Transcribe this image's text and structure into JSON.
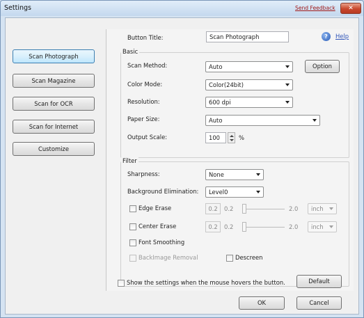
{
  "window": {
    "title": "Settings",
    "feedback_label": "Send Feedback",
    "close_glyph": "✕"
  },
  "sidebar": {
    "items": [
      {
        "label": "Scan Photograph",
        "active": true
      },
      {
        "label": "Scan Magazine"
      },
      {
        "label": "Scan for OCR"
      },
      {
        "label": "Scan for Internet"
      },
      {
        "label": "Customize"
      }
    ]
  },
  "header": {
    "button_title_label": "Button Title:",
    "button_title_value": "Scan Photograph",
    "help_glyph": "?",
    "help_label": "Help"
  },
  "basic": {
    "group_label": "Basic",
    "scan_method_label": "Scan Method:",
    "scan_method_value": "Auto",
    "option_button": "Option",
    "color_mode_label": "Color Mode:",
    "color_mode_value": "Color(24bit)",
    "resolution_label": "Resolution:",
    "resolution_value": "600 dpi",
    "paper_size_label": "Paper Size:",
    "paper_size_value": "Auto",
    "output_scale_label": "Output Scale:",
    "output_scale_value": "100",
    "output_scale_unit": "%"
  },
  "filter": {
    "group_label": "Filter",
    "sharpness_label": "Sharpness:",
    "sharpness_value": "None",
    "bg_elim_label": "Background Elimination:",
    "bg_elim_value": "Level0",
    "edge_erase_label": "Edge Erase",
    "edge_erase_box": "0.2",
    "edge_erase_min": "0.2",
    "edge_erase_max": "2.0",
    "edge_erase_unit": "inch",
    "center_erase_label": "Center Erase",
    "center_erase_box": "0.2",
    "center_erase_min": "0.2",
    "center_erase_max": "2.0",
    "center_erase_unit": "inch",
    "font_smoothing_label": "Font Smoothing",
    "backimage_label": "BackImage Removal",
    "descreen_label": "Descreen"
  },
  "footer": {
    "show_settings_label": "Show the settings when the mouse hovers the button.",
    "default_button": "Default",
    "ok_button": "OK",
    "cancel_button": "Cancel"
  },
  "colors": {
    "accent": "#3c7fb1",
    "link": "#2f54b8",
    "feedback": "#a01818",
    "close": "#c8482e"
  }
}
